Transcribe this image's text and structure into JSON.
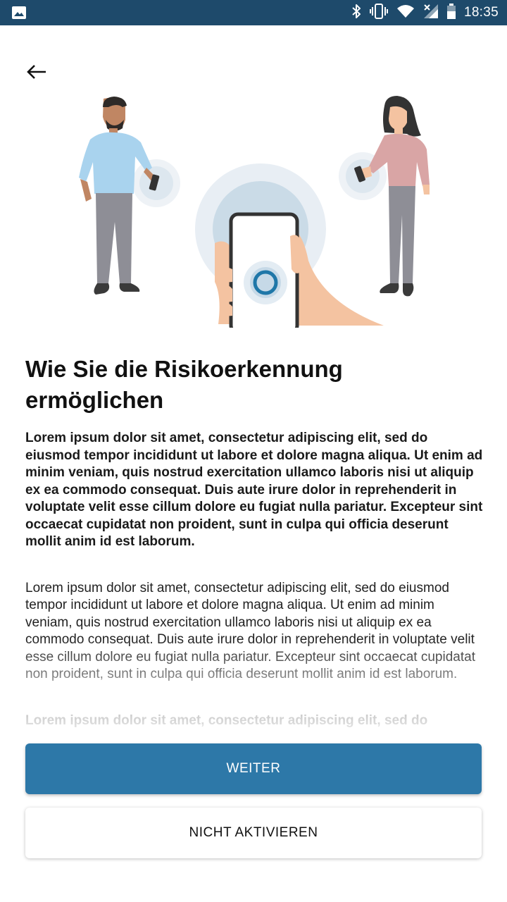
{
  "status_bar": {
    "time": "18:35",
    "icons": [
      "image-icon",
      "bluetooth-icon",
      "vibrate-icon",
      "wifi-icon",
      "signal-icon",
      "battery-icon"
    ],
    "background_color": "#1e4a6b"
  },
  "navigation": {
    "back_icon": "arrow-left-icon"
  },
  "illustration": {
    "subject": "two-people-with-phones-and-hand-holding-phone"
  },
  "header": {
    "title": "Wie Sie die Risikoerkennung ermöglichen"
  },
  "body": {
    "paragraphs": [
      "Lorem ipsum dolor sit amet, consectetur adipiscing elit, sed do eiusmod tempor incididunt ut labore et dolore magna aliqua. Ut enim ad minim veniam, quis nostrud exercitation ullamco laboris nisi ut aliquip ex ea commodo consequat. Duis aute irure dolor in reprehenderit in voluptate velit esse cillum dolore eu fugiat nulla pariatur. Excepteur sint occaecat cupidatat non proident, sunt in culpa qui officia deserunt mollit anim id est laborum.",
      "Lorem ipsum dolor sit amet, consectetur adipiscing elit, sed do eiusmod tempor incididunt ut labore et dolore magna aliqua. Ut enim ad minim veniam, quis nostrud exercitation ullamco laboris nisi ut aliquip ex ea commodo consequat. Duis aute irure dolor in reprehenderit in voluptate velit esse cillum dolore eu fugiat nulla pariatur. Excepteur sint occaecat cupidatat non proident, sunt in culpa qui officia deserunt mollit anim id est laborum.",
      "Lorem ipsum dolor sit amet, consectetur adipiscing elit, sed do"
    ]
  },
  "actions": {
    "primary_label": "WEITER",
    "secondary_label": "NICHT AKTIVIEREN",
    "primary_color": "#2d78a8"
  }
}
